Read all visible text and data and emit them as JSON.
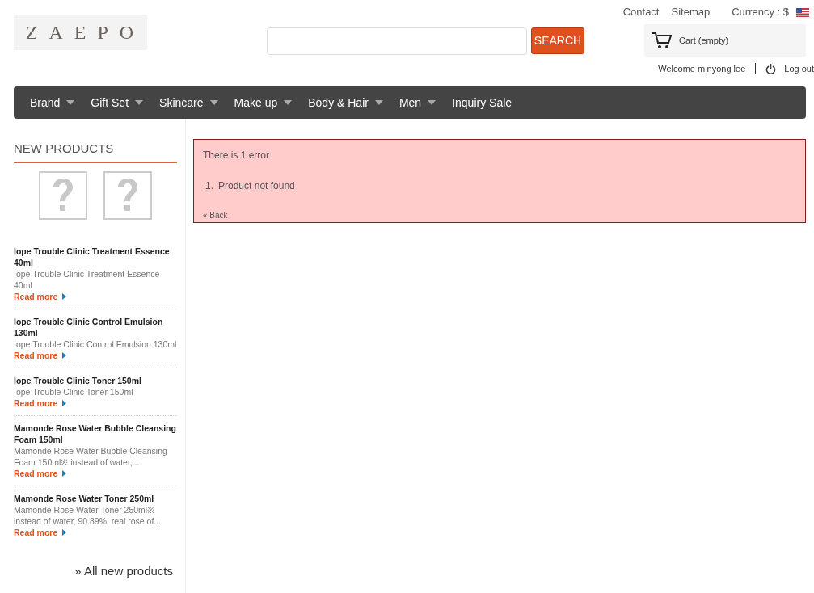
{
  "header": {
    "logo": "ZAEPO",
    "search": {
      "button": "SEARCH"
    },
    "links": [
      "Contact",
      "Sitemap"
    ],
    "currency": "Currency : $",
    "cart": "Cart (empty)",
    "welcome": "Welcome minyong lee",
    "logout": "Log out"
  },
  "nav": [
    "Brand",
    "Gift Set",
    "Skincare",
    "Make up",
    "Body & Hair",
    "Men",
    "Inquiry Sale"
  ],
  "nav_dropdown": [
    true,
    true,
    true,
    true,
    true,
    true,
    false
  ],
  "sidebar": {
    "title": "NEW PRODUCTS",
    "thumbnails": [
      {
        "kind": "missing-image"
      },
      {
        "kind": "missing-image"
      }
    ],
    "products": [
      {
        "name": "Iope Trouble Clinic Treatment Essence 40ml",
        "description": "Iope Trouble Clinic Treatment Essence 40ml",
        "link": "Read more"
      },
      {
        "name": "Iope Trouble Clinic Control Emulsion 130ml",
        "description": "Iope Trouble Clinic Control Emulsion 130ml",
        "link": "Read more"
      },
      {
        "name": "Iope Trouble Clinic Toner 150ml",
        "description": "Iope Trouble Clinic Toner 150ml",
        "link": "Read more"
      },
      {
        "name": "Mamonde Rose Water Bubble Cleansing Foam 150ml",
        "description": "Mamonde Rose Water Bubble Cleansing Foam 150ml※ instead of water,...",
        "link": "Read more"
      },
      {
        "name": "Mamonde Rose Water Toner 250ml",
        "description": "Mamonde Rose Water Toner 250ml※ instead of water, 90.89%, real rose of...",
        "link": "Read more"
      }
    ],
    "all_link": "» All new products"
  },
  "error": {
    "title": "There is 1 error",
    "items": [
      {
        "number": "1.",
        "text": "Product not found"
      }
    ],
    "back": "« Back"
  }
}
